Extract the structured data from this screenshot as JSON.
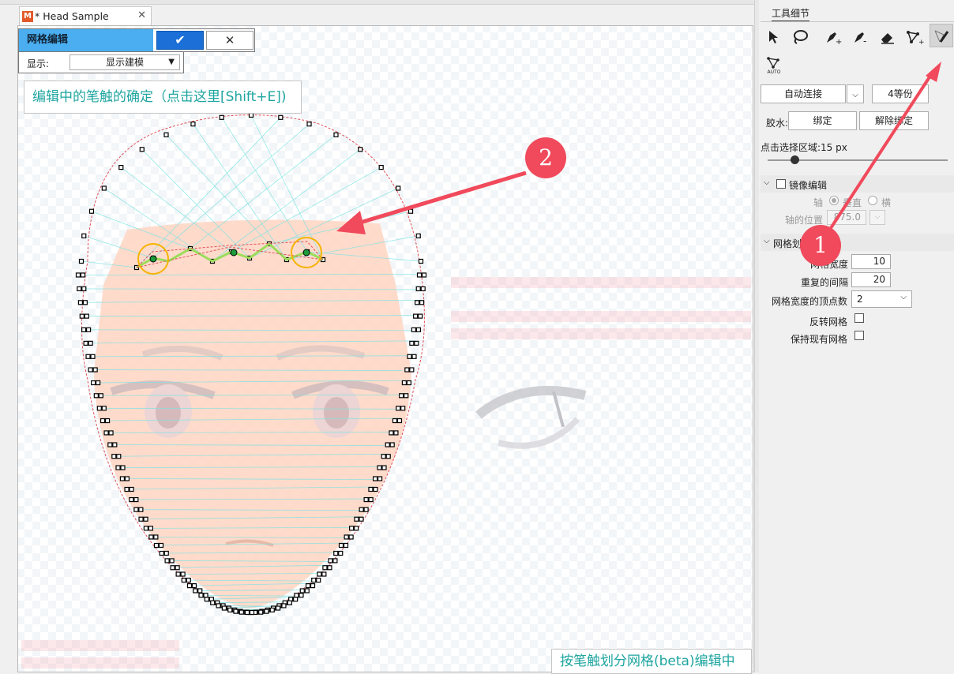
{
  "document": {
    "tab_title": "* Head Sample",
    "logo_letter": "M"
  },
  "mesh_edit": {
    "mode_label": "网格编辑",
    "confirm_icon": "check-icon",
    "cancel_icon": "close-icon",
    "display_label": "显示:",
    "display_value": "显示建模"
  },
  "canvas": {
    "confirm_hint": "编辑中的笔触的确定（点击这里[Shift+E])",
    "status_text": "按笔触划分网格(beta)编辑中"
  },
  "tool_panel": {
    "tab_label": "工具细节",
    "tools": [
      {
        "name": "select-arrow-icon"
      },
      {
        "name": "lasso-icon"
      },
      {
        "name": "pen-add-icon"
      },
      {
        "name": "pen-subtract-icon"
      },
      {
        "name": "eraser-icon"
      },
      {
        "name": "add-vertex-icon"
      },
      {
        "name": "stroke-mesh-icon",
        "active": true
      },
      {
        "name": "auto-mesh-icon",
        "sub_label": "AUTO"
      }
    ],
    "auto_connect_label": "自动连接",
    "divide_label": "4等份",
    "glue_label": "胶水:",
    "bind_label": "绑定",
    "unbind_label": "解除绑定",
    "click_area_label": "点击选择区域:15 px",
    "slider_value": 0.15,
    "mirror_label": "镜像编辑",
    "axis_label": "轴",
    "axis_vertical": "垂直",
    "axis_horizontal": "横",
    "axis_position_label": "轴的位置",
    "axis_position_value": "875.0",
    "mesh_section_label": "网格划分",
    "mesh_width_label": "网格宽度",
    "mesh_width_value": "10",
    "repeat_interval_label": "重复的间隔",
    "repeat_interval_value": "20",
    "vertex_count_label": "网格宽度的顶点数",
    "vertex_count_value": "2",
    "invert_label": "反转网格",
    "keep_label": "保持现有网格"
  },
  "callouts": {
    "badge_1": "1",
    "badge_2": "2"
  },
  "colors": {
    "accent_blue": "#4aaef0",
    "confirm_blue": "#1b6fd6",
    "hint_teal": "#1ea5a0",
    "callout_red": "#f04a5c",
    "skin": "#ffd7c5",
    "mesh_line": "#7fe3e3",
    "outline_red": "#e0505a",
    "stroke_green": "#9bdc5a",
    "highlight_orange": "#f5b400"
  }
}
